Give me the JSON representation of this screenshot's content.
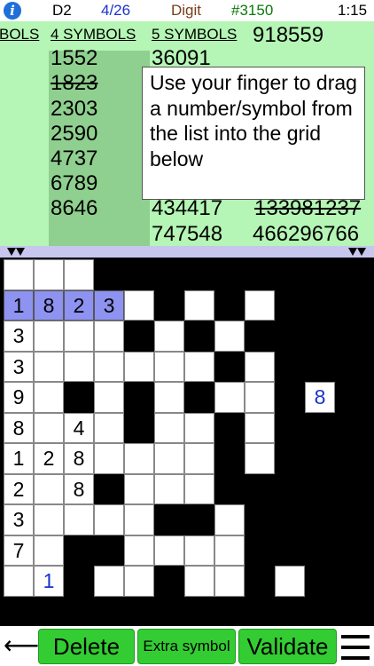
{
  "status": {
    "info_icon": "i",
    "level": "D2",
    "date": "4/26",
    "game": "Digit",
    "puzzle_id": "#3150",
    "time": "1:15"
  },
  "lists": {
    "headers": [
      "BOLS",
      "4 SYMBOLS",
      "5 SYMBOLS"
    ],
    "four_symbols": [
      {
        "text": "1552",
        "used": false
      },
      {
        "text": "1823",
        "used": true
      },
      {
        "text": "2303",
        "used": false
      },
      {
        "text": "2590",
        "used": false
      },
      {
        "text": "4737",
        "used": false
      },
      {
        "text": "6789",
        "used": false
      },
      {
        "text": "8646",
        "used": false
      }
    ],
    "five_symbols": [
      {
        "text": "36091",
        "used": false
      }
    ],
    "six_symbols": [
      {
        "text": "918559",
        "used": false
      },
      {
        "text": "434417",
        "used": false
      },
      {
        "text": "747548",
        "used": false
      }
    ],
    "nine_symbols": [
      {
        "text": "133981237",
        "used": true
      },
      {
        "text": "466296766",
        "used": false
      }
    ]
  },
  "tooltip": "Use your finger to drag a number/symbol from the list into the grid below",
  "grid": {
    "rows": [
      "...######",
      "####.#.#.#",
      "#...#.#.##",
      "#......#.#",
      "#.#.#.#..#",
      "#...#..#.#",
      "###....#.#",
      "#..#...###",
      "#....##.##",
      "..##....##",
      "..#..#..#."
    ],
    "digits": [
      {
        "r": 1,
        "c": 0,
        "v": "1",
        "sel": true
      },
      {
        "r": 1,
        "c": 1,
        "v": "8",
        "sel": true
      },
      {
        "r": 1,
        "c": 2,
        "v": "2",
        "sel": true
      },
      {
        "r": 1,
        "c": 3,
        "v": "3",
        "sel": true
      },
      {
        "r": 2,
        "c": 0,
        "v": "3"
      },
      {
        "r": 3,
        "c": 0,
        "v": "3"
      },
      {
        "r": 4,
        "c": 0,
        "v": "9"
      },
      {
        "r": 4,
        "c": 10,
        "v": "8",
        "extra": true
      },
      {
        "r": 5,
        "c": 0,
        "v": "8"
      },
      {
        "r": 5,
        "c": 2,
        "v": "4"
      },
      {
        "r": 6,
        "c": 0,
        "v": "1"
      },
      {
        "r": 6,
        "c": 1,
        "v": "2"
      },
      {
        "r": 6,
        "c": 2,
        "v": "8"
      },
      {
        "r": 7,
        "c": 0,
        "v": "2"
      },
      {
        "r": 7,
        "c": 2,
        "v": "8"
      },
      {
        "r": 8,
        "c": 0,
        "v": "3"
      },
      {
        "r": 9,
        "c": 0,
        "v": "7"
      },
      {
        "r": 10,
        "c": 1,
        "v": "1",
        "extra": true
      }
    ]
  },
  "toolbar": {
    "back_icon": "⟵",
    "delete_label": "Delete",
    "extra_symbol_label": "Extra symbol",
    "validate_label": "Validate"
  },
  "colors": {
    "list_bg": "#b5f5b5",
    "column_highlight": "#8fcf8f",
    "selected_cell": "#8e92f0",
    "button": "#33cc33",
    "date": "#1a33cc",
    "game": "#7a3e1a",
    "puzzle_id": "#0a7a0a"
  }
}
